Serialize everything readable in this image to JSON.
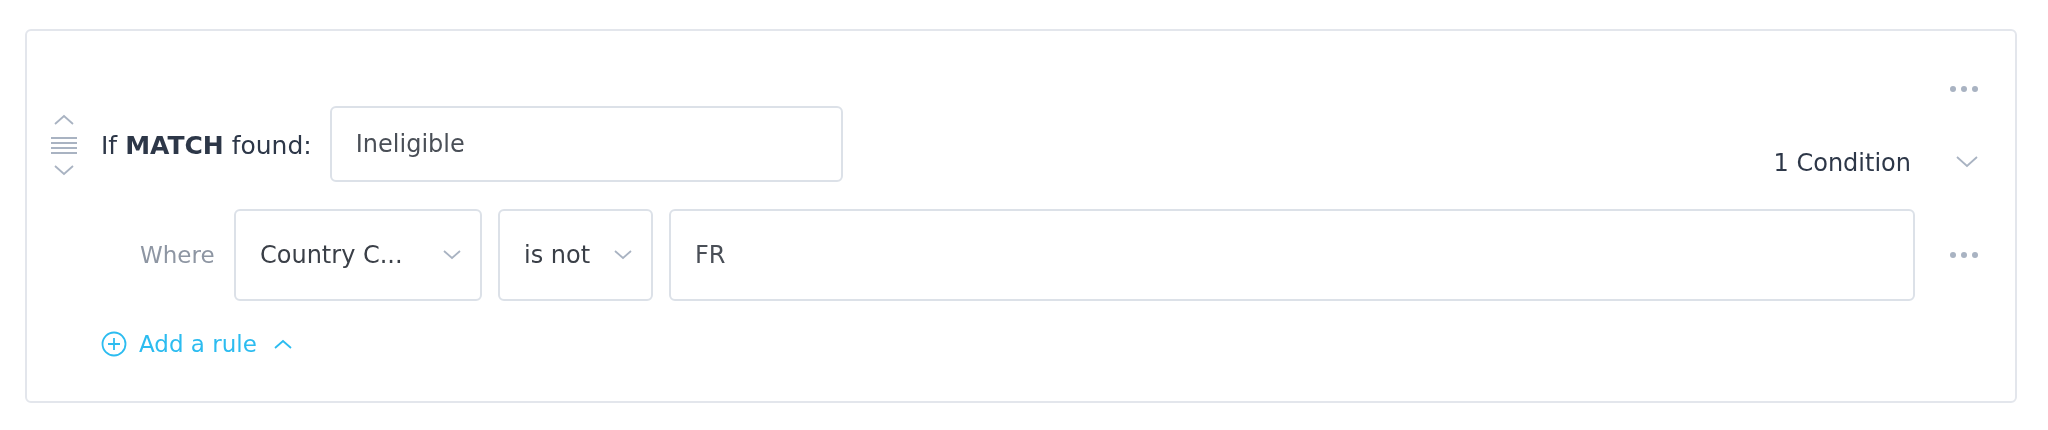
{
  "rule_group": {
    "label": "If **MATCH** found:",
    "outcome": {
      "value": "Ineligible"
    },
    "condition_count": "1 Condition",
    "rules": [
      {
        "where": "Where",
        "field": "Country C...",
        "operator": "is not",
        "value": "FR"
      }
    ],
    "add_rule": "Add a rule"
  }
}
